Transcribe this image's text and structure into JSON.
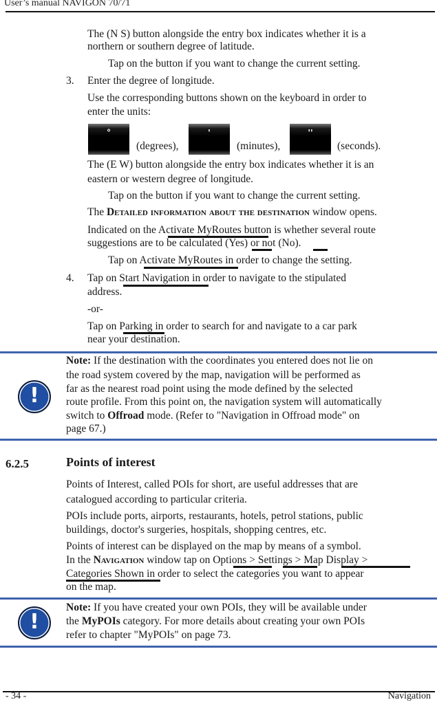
{
  "header": {
    "title": "User’s manual NAVIGON 70/71"
  },
  "footer": {
    "page": "- 34 -",
    "section": "Navigation"
  },
  "body": {
    "ns_line1": "The (N S) button alongside the entry box indicates whether it is a",
    "ns_line2": "northern or southern degree of latitude.",
    "tap_button_1": "Tap on the button if you want to change the current setting.",
    "step3_num": "3.",
    "step3_text": "Enter the degree of longitude.",
    "units_line1": "Use the corresponding buttons shown on the keyboard in order to",
    "units_line2": "enter the units:",
    "keys": [
      {
        "glyph": "°",
        "label": "(degrees),"
      },
      {
        "glyph": "'",
        "label": "(minutes),"
      },
      {
        "glyph": "''",
        "label": "(seconds)."
      }
    ],
    "ew_line1": "The (E W) button alongside the entry box indicates whether it is an",
    "ew_line2": "eastern or western degree of longitude.",
    "tap_button_2": "Tap on the button if you want to change the current setting.",
    "detail_pre": "The ",
    "detail_window": "Detailed information about the destination",
    "detail_post": " window opens.",
    "myroutes_line1": "Indicated on the Activate MyRoutes button is whether several route",
    "myroutes_line2": "suggestions are to be calculated (Yes) or not (No).",
    "tap_myroutes": "Tap on Activate MyRoutes in order to change the setting.",
    "step4_num": "4.",
    "step4_line1": "Tap on Start Navigation in order to navigate to the stipulated",
    "step4_line2": "address.",
    "or": "-or-",
    "parking_line1": "Tap on Parking in order to search for and navigate to a car park",
    "parking_line2": "near your destination."
  },
  "note1": {
    "label": "Note:",
    "line1": " If the destination with the coordinates you entered does not lie on",
    "line2": "the road system covered by the map, navigation will be performed as",
    "line3": "far as the nearest road point using the mode defined by the selected",
    "line4": "route profile. From this point on, the navigation system will automatically",
    "line5_pre": "switch to ",
    "line5_bold": "Offroad",
    "line5_post": " mode. (Refer to \"Navigation in Offroad mode\" on",
    "line6": "page 67.)"
  },
  "section": {
    "number": "6.2.5",
    "title": "Points of interest",
    "p1_line1": "Points of Interest, called POIs for short, are useful addresses that are",
    "p1_line2": "catalogued according to particular criteria.",
    "p2_line1": "POIs include ports, airports, restaurants, hotels, petrol stations, public",
    "p2_line2": "buildings, doctor's surgeries, hospitals, shopping centres, etc.",
    "p3_line1": "Points of interest can be displayed on the map by means of a symbol.",
    "p3_line2_pre": "In the ",
    "p3_line2_window": "Navigation",
    "p3_line2_post": " window tap on Options > Settings > Map Display >",
    "p3_line3": "Categories Shown in order to select the categories you want to appear",
    "p3_line4": "on the map."
  },
  "note2": {
    "label": "Note:",
    "line1": " If you have created your own POIs, they will be available under",
    "line2_pre": "the ",
    "line2_bold": "MyPOIs",
    "line2_post": " category. For more details about creating your own POIs",
    "line3": "refer to chapter \"MyPOIs\" on page 73."
  },
  "colors": {
    "note_rule": "#3f62ad",
    "note_icon": "#1f4ea3"
  },
  "icons": {
    "note": "exclamation-circle-icon"
  }
}
